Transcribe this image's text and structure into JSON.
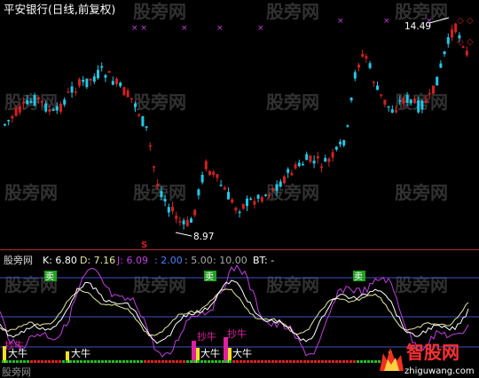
{
  "main_panel": {
    "title": "平安银行(日线,前复权)",
    "high_label": "14.49",
    "low_label": "8.97",
    "signal_glyph": "S"
  },
  "indicator_panel": {
    "name": "股旁网",
    "k_label": "K: 6.80",
    "d_label": "D: 7.16",
    "j_label": "J: 6.09",
    "p1": ": 2.00",
    "p2": ": 5.00",
    "p3": ": 10.00",
    "bt": "BT: -",
    "sell_label": "卖",
    "bull_label": "大牛",
    "buy_label": "抄牛"
  },
  "watermarks": {
    "main": "股旁网",
    "logo": "智股网",
    "url": "zhiguwang.com",
    "bottom_left": "股旁网"
  },
  "colors": {
    "up": "#d42020",
    "down": "#22c8e8",
    "k_line": "#ffffff",
    "d_line": "#e8e8a0",
    "j_line": "#c040e0",
    "sell_box": "#20a020",
    "bull_yellow": "#f0e020",
    "buy_magenta": "#e020a0",
    "grid": "#4050c0"
  }
}
